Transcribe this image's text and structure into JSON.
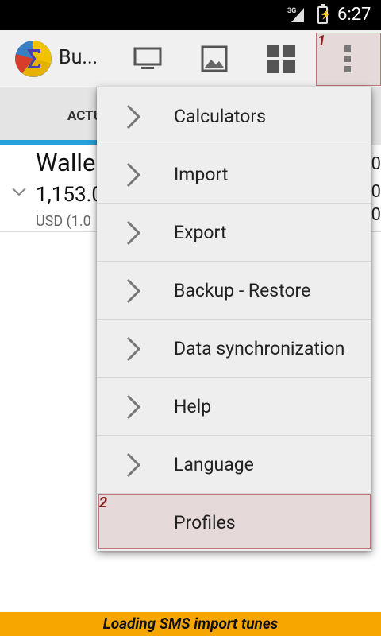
{
  "status_bar": {
    "network": "3G",
    "time": "6:27"
  },
  "app": {
    "title": "Bu..."
  },
  "action_bar": {
    "icons": [
      "monitor-icon",
      "image-icon",
      "grid-icon",
      "overflow-menu-icon"
    ],
    "highlight_number": "1"
  },
  "tabs": {
    "active_label": "ACTU"
  },
  "account": {
    "name": "Walle",
    "amount": "1,153.0",
    "currency": "USD (1.0",
    "right_values": [
      "0",
      "0",
      "0"
    ]
  },
  "menu": {
    "items": [
      {
        "label": "Calculators"
      },
      {
        "label": "Import"
      },
      {
        "label": "Export"
      },
      {
        "label": "Backup - Restore"
      },
      {
        "label": "Data synchronization"
      },
      {
        "label": "Help"
      },
      {
        "label": "Language"
      },
      {
        "label": "Profiles"
      }
    ],
    "highlight_number": "2"
  },
  "notification": {
    "text": "Loading SMS import tunes"
  },
  "colors": {
    "accent": "#28a0d9",
    "notification_bg": "#f7a600",
    "highlight_bg": "#e6d9d9",
    "highlight_num": "#8b2222"
  }
}
